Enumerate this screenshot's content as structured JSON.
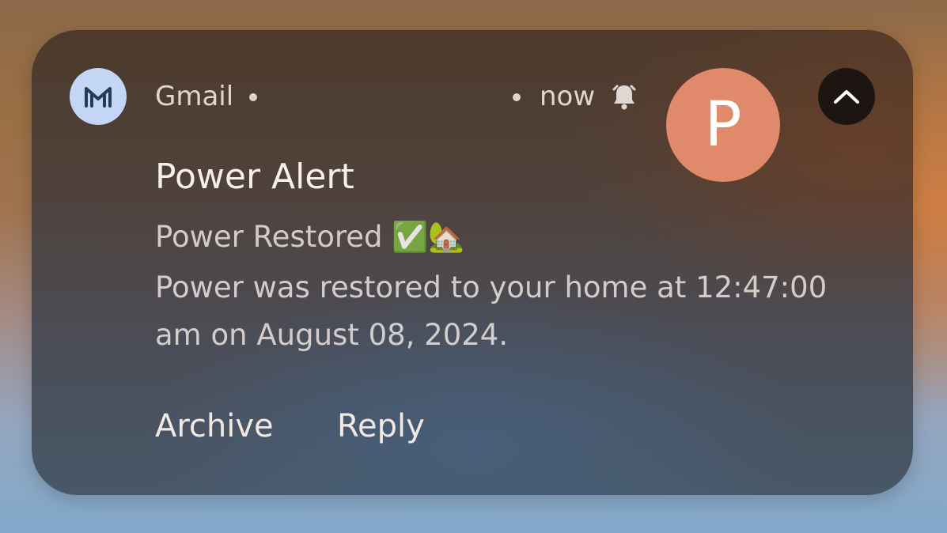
{
  "notification": {
    "app_name": "Gmail",
    "time": "now",
    "avatar_letter": "P",
    "title": "Power Alert",
    "subject": "Power Restored ✅🏡",
    "body": "Power was restored to your home at 12:47:00 am on August 08, 2024.",
    "icons": {
      "app": "gmail-icon",
      "bell": "bell-icon",
      "collapse": "chevron-up-icon"
    },
    "colors": {
      "avatar": "#e0896b",
      "app_icon_bg": "#c4d6f5",
      "collapse_bg": "#1c1512"
    }
  },
  "actions": {
    "archive_label": "Archive",
    "reply_label": "Reply"
  }
}
